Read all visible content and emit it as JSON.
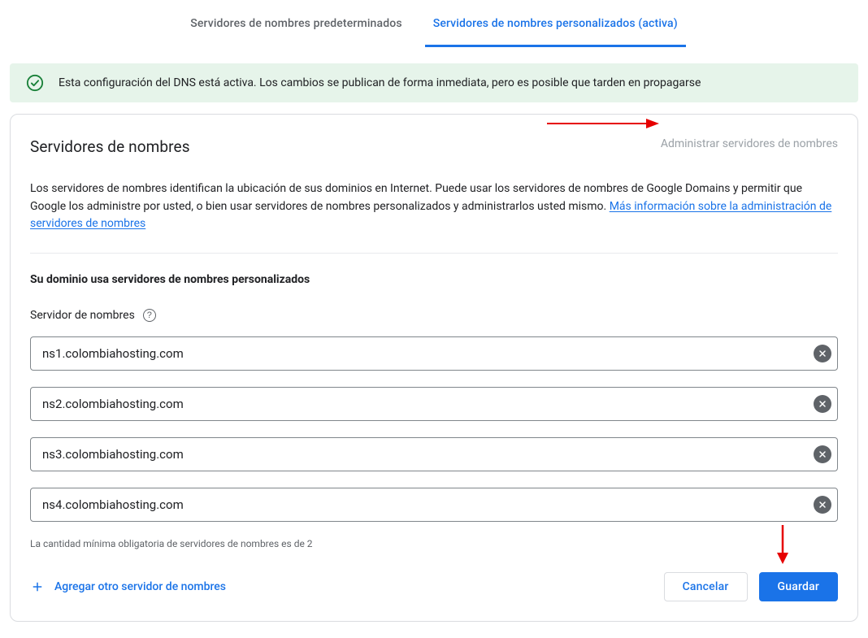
{
  "tabs": {
    "default_label": "Servidores de nombres predeterminados",
    "custom_label": "Servidores de nombres personalizados (activa)"
  },
  "banner": {
    "message": "Esta configuración del DNS está activa. Los cambios se publican de forma inmediata, pero es posible que tarden en propagarse"
  },
  "card": {
    "title": "Servidores de nombres",
    "manage_label": "Administrar servidores de nombres",
    "description_part1": "Los servidores de nombres identifican la ubicación de sus dominios en Internet. Puede usar los servidores de nombres de Google Domains y permitir que Google los administre por usted, o bien usar servidores de nombres personalizados y administrarlos usted mismo. ",
    "description_link": "Más información sobre la administración de servidores de nombres",
    "custom_heading": "Su dominio usa servidores de nombres personalizados",
    "field_label": "Servidor de nombres",
    "nameservers": [
      {
        "value": "ns1.colombiahosting.com"
      },
      {
        "value": "ns2.colombiahosting.com"
      },
      {
        "value": "ns3.colombiahosting.com"
      },
      {
        "value": "ns4.colombiahosting.com"
      }
    ],
    "hint": "La cantidad mínima obligatoria de servidores de nombres es de 2",
    "add_label": "Agregar otro servidor de nombres",
    "cancel_label": "Cancelar",
    "save_label": "Guardar"
  }
}
